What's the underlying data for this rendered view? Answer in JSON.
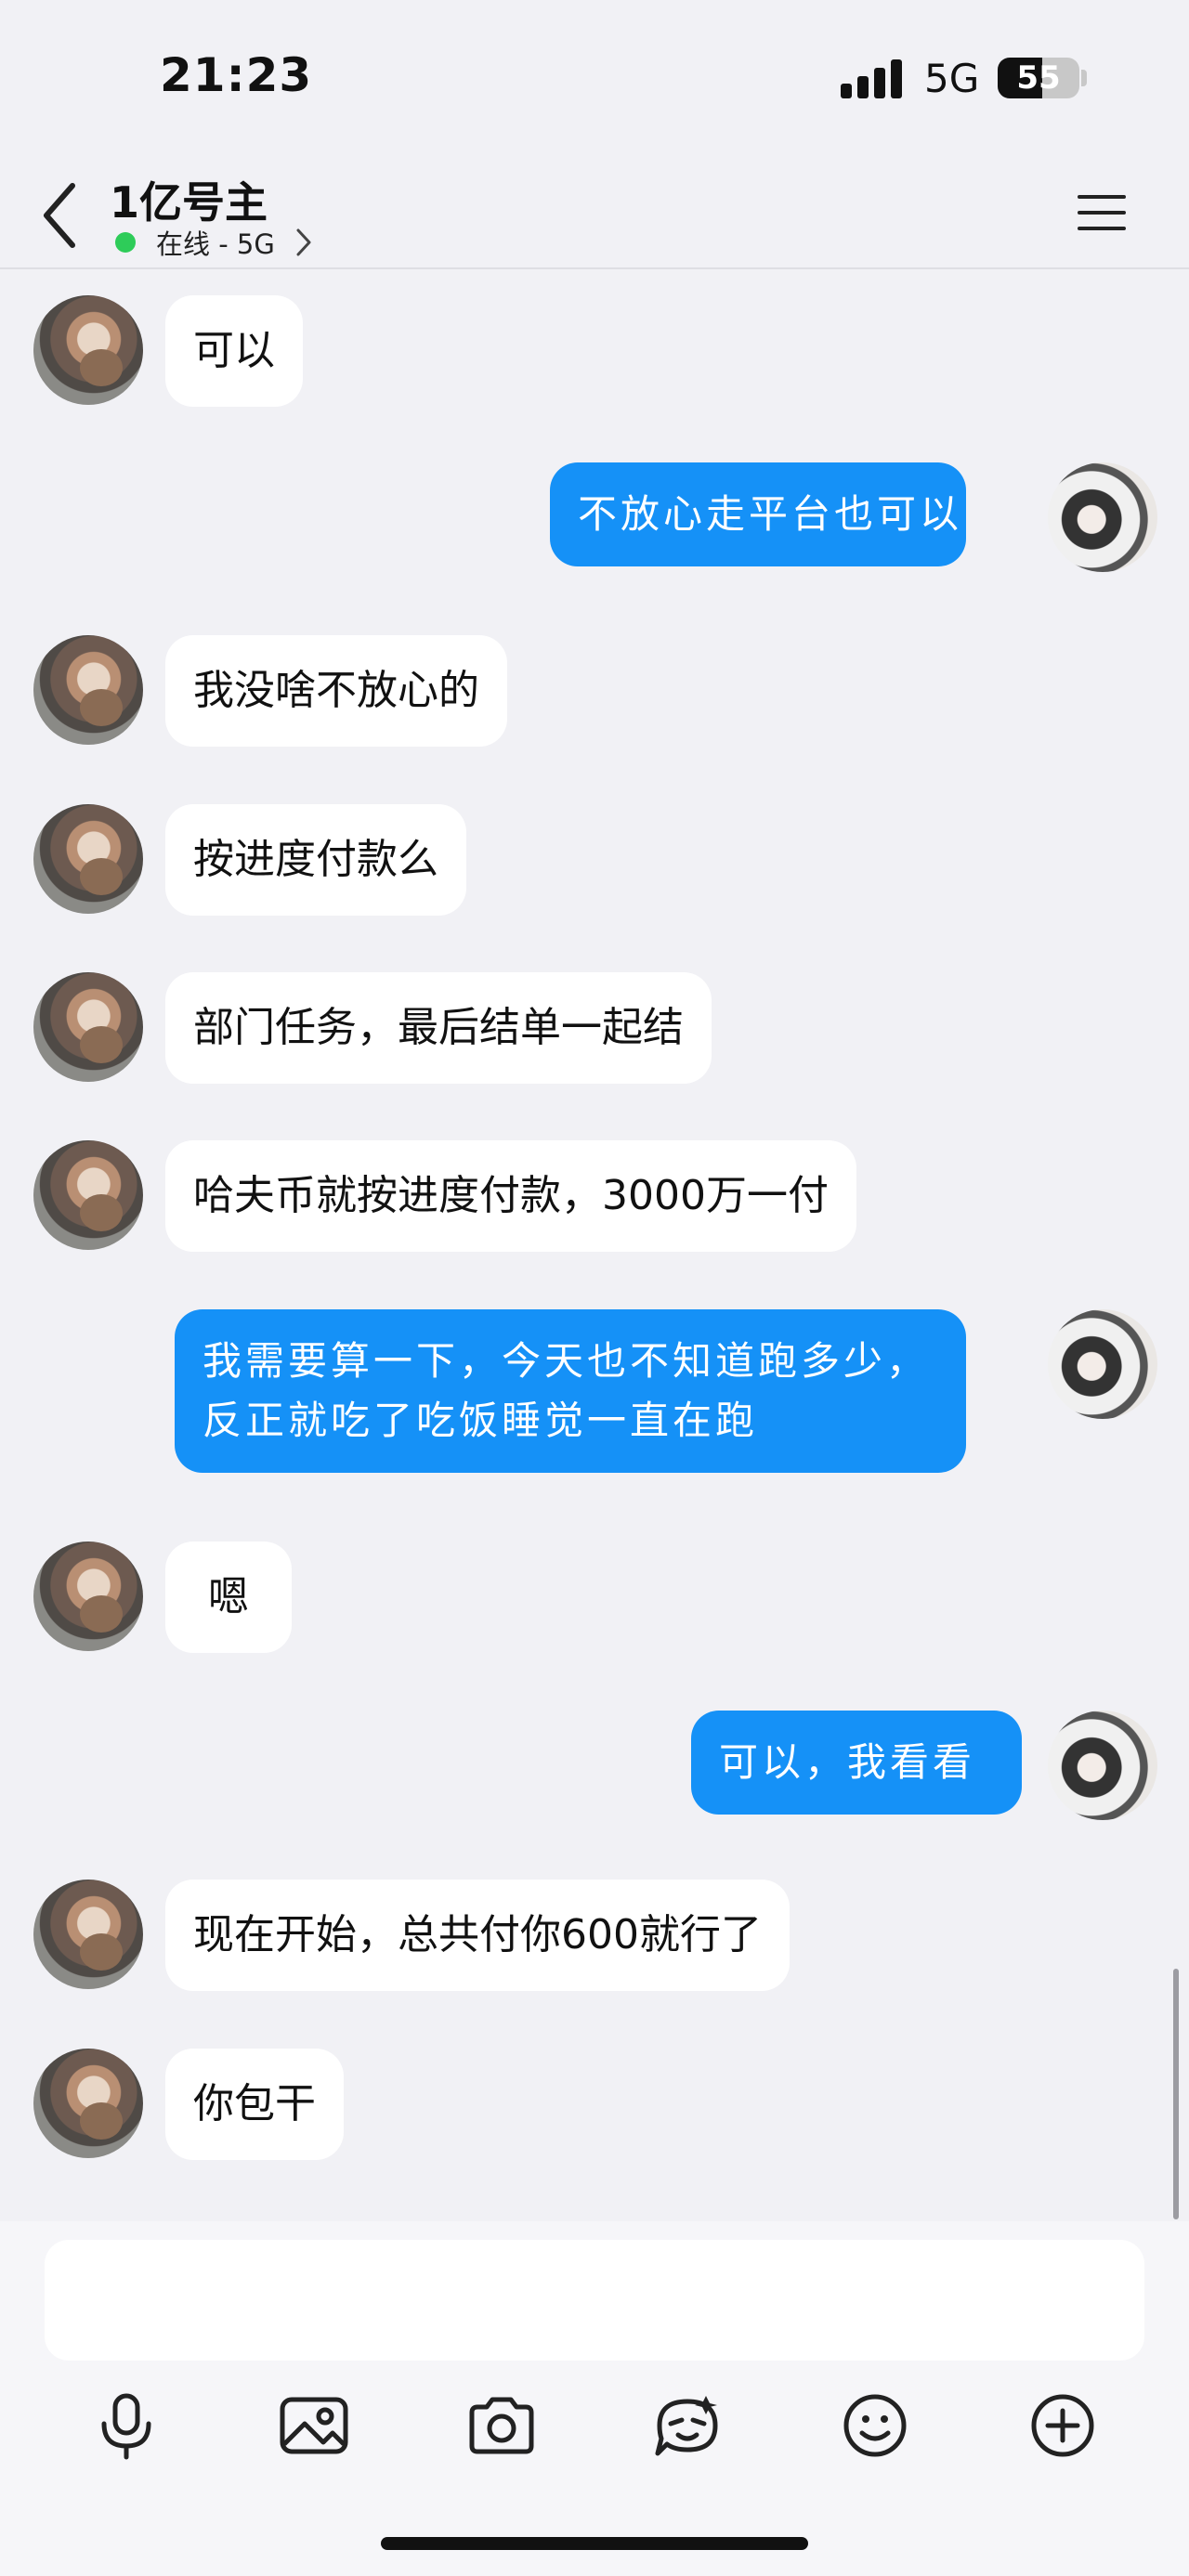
{
  "status_bar": {
    "time": "21:23",
    "network": "5G",
    "battery": "55",
    "battery_level": 0.55
  },
  "header": {
    "title": "1亿号主",
    "subtitle": "在线 - 5G"
  },
  "messages": [
    {
      "side": "in",
      "text": "可以"
    },
    {
      "side": "out",
      "text": "不放心走平台也可以"
    },
    {
      "side": "in",
      "text": "我没啥不放心的"
    },
    {
      "side": "in",
      "text": "按进度付款么"
    },
    {
      "side": "in",
      "text": "部门任务，最后结单一起结"
    },
    {
      "side": "in",
      "text": "哈夫币就按进度付款，3000万一付"
    },
    {
      "side": "out",
      "text": "我需要算一下，今天也不知道跑多少，反正就吃了吃饭睡觉一直在跑"
    },
    {
      "side": "in",
      "text": "嗯"
    },
    {
      "side": "out",
      "text": "可以，我看看"
    },
    {
      "side": "in",
      "text": "现在开始，总共付你600就行了"
    },
    {
      "side": "in",
      "text": "你包干"
    }
  ],
  "input": {
    "value": "",
    "placeholder": ""
  },
  "toolbar": [
    "microphone-icon",
    "image-icon",
    "camera-icon",
    "sticker-icon",
    "emoji-icon",
    "plus-icon"
  ],
  "colors": {
    "outgoing_bubble": "#1591f7",
    "incoming_bubble": "#ffffff",
    "background": "#f1f1f5",
    "online": "#2ecc59"
  }
}
